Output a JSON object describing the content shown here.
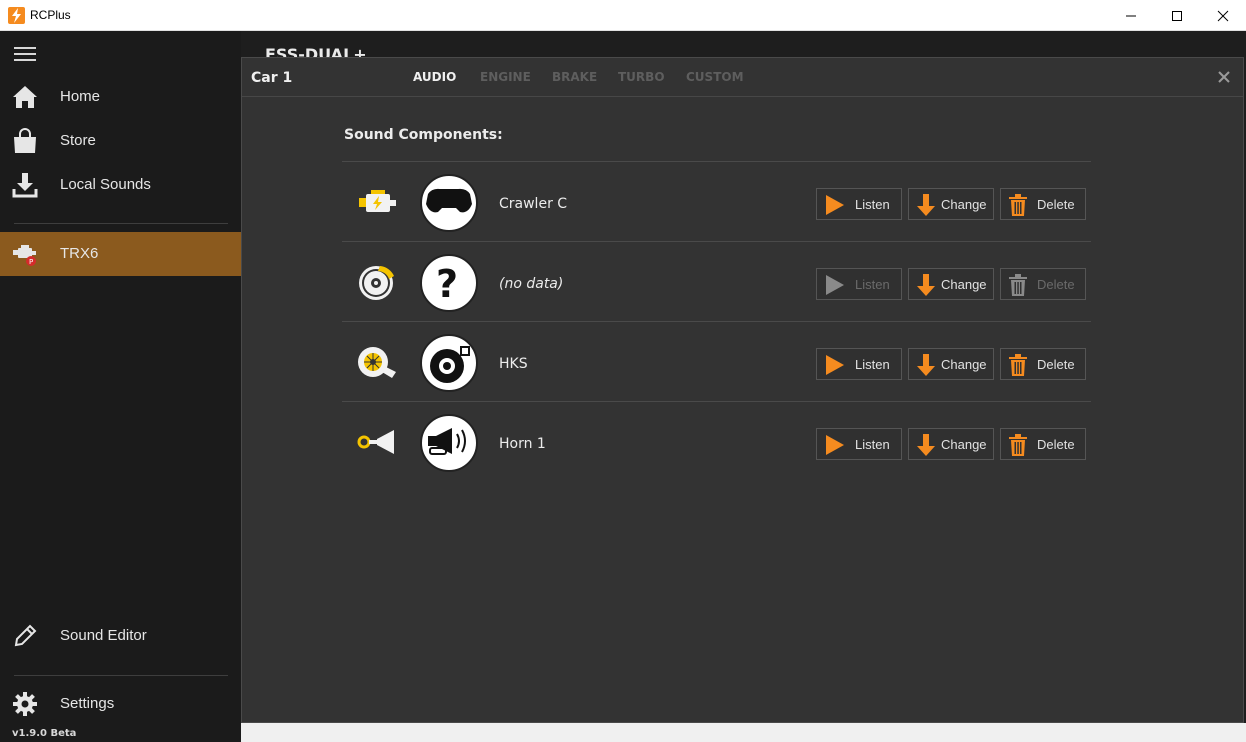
{
  "window": {
    "title": "RCPlus"
  },
  "sidebar": {
    "items": [
      {
        "label": "Home",
        "icon": "home-icon"
      },
      {
        "label": "Store",
        "icon": "shopping-bag-icon"
      },
      {
        "label": "Local Sounds",
        "icon": "download-icon"
      }
    ],
    "device": {
      "label": "TRX6",
      "icon": "engine-icon"
    },
    "bottom_items": [
      {
        "label": "Sound Editor",
        "icon": "pencil-icon"
      },
      {
        "label": "Settings",
        "icon": "gear-icon"
      }
    ],
    "version": "v1.9.0 Beta"
  },
  "main": {
    "device_title": "ESS-DUAL+"
  },
  "panel": {
    "title": "Car 1",
    "tabs": [
      "AUDIO",
      "ENGINE",
      "BRAKE",
      "TURBO",
      "CUSTOM"
    ],
    "active_tab": "AUDIO",
    "section_title": "Sound Components:",
    "buttons": {
      "listen": "Listen",
      "change": "Change",
      "delete": "Delete"
    },
    "components": [
      {
        "category": "engine",
        "name": "Crawler C",
        "has_data": true
      },
      {
        "category": "brake",
        "name": "(no data)",
        "has_data": false
      },
      {
        "category": "turbo",
        "name": "HKS",
        "has_data": true
      },
      {
        "category": "horn",
        "name": "Horn 1",
        "has_data": true
      }
    ]
  },
  "colors": {
    "accent": "#f58b1f",
    "active_nav": "#8b5a1e",
    "category_icon": "#f5c400"
  }
}
